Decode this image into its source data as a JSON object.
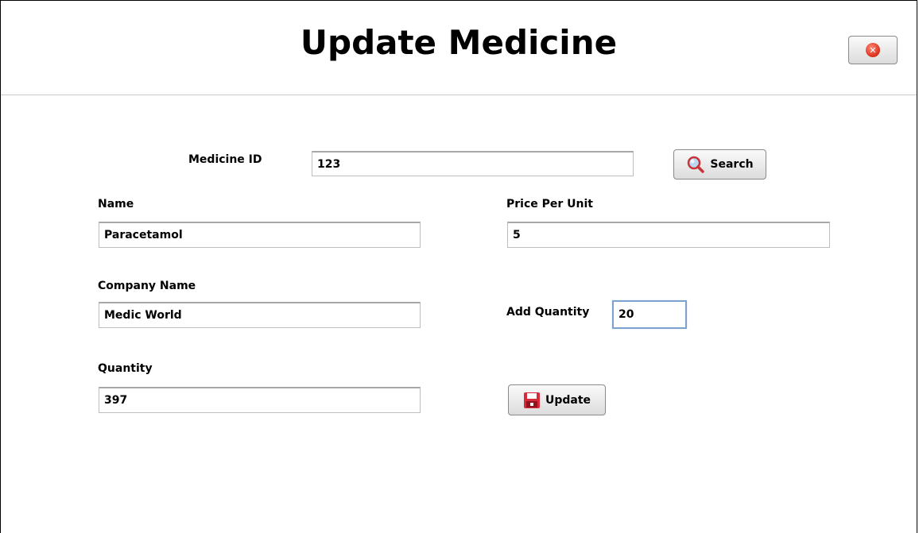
{
  "window": {
    "title": "Update Medicine"
  },
  "icons": {
    "close": "close-icon",
    "search": "search-icon",
    "update": "save-icon"
  },
  "form": {
    "medicine_id": {
      "label": "Medicine ID",
      "value": "123"
    },
    "search_button": "Search",
    "name": {
      "label": "Name",
      "value": "Paracetamol"
    },
    "price_per_unit": {
      "label": "Price Per Unit",
      "value": "5"
    },
    "company_name": {
      "label": "Company Name",
      "value": "Medic World"
    },
    "add_quantity": {
      "label": "Add Quantity",
      "value": "20"
    },
    "quantity": {
      "label": "Quantity",
      "value": "397"
    },
    "update_button": "Update"
  },
  "colors": {
    "close_red": "#e03a25",
    "focus_blue": "#7da2ce",
    "save_red": "#d8283a"
  }
}
